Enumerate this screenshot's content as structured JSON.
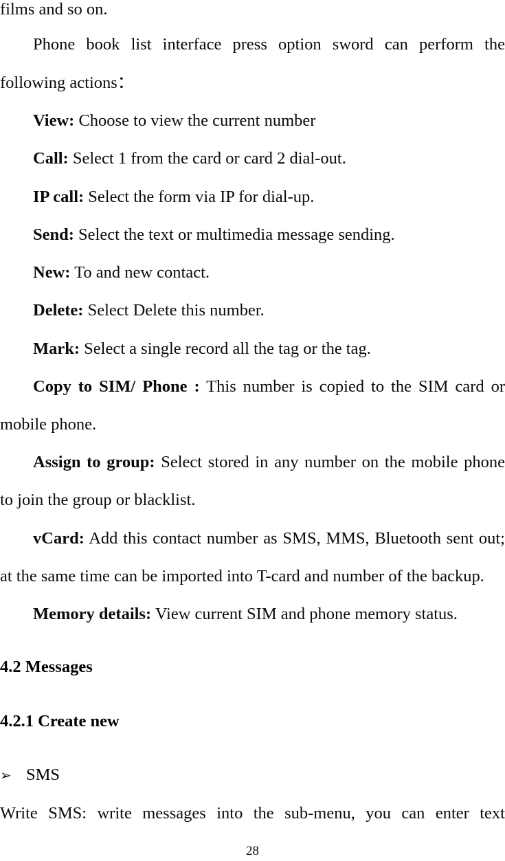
{
  "document": {
    "type": "user-manual-page",
    "page_number": "28",
    "body_font": "serif",
    "text_color": "#0b0b0b",
    "background_color": "#ffffff"
  },
  "content": {
    "continued_line": "films and so on.",
    "intro_paragraph": {
      "line1": "Phone book list interface press option sword can perform the",
      "line2": "following actions："
    },
    "actions": [
      {
        "label": "View:",
        "text": "Choose to view the current number"
      },
      {
        "label": "Call:",
        "text": "Select 1 from the card or card 2 dial-out."
      },
      {
        "label": "IP call:",
        "text": "Select the form via IP for dial-up."
      },
      {
        "label": "Send:",
        "text": "Select the text or multimedia message sending."
      },
      {
        "label": "New:",
        "text": "To and new contact."
      },
      {
        "label": "Delete:",
        "text": "Select Delete this number."
      },
      {
        "label": "Mark:",
        "text": "Select a single record all the tag or the tag."
      }
    ],
    "copy_to_sim": {
      "label": "Copy to SIM/ Phone :",
      "line1": "This number is copied to the SIM card or",
      "line2": "mobile phone."
    },
    "assign_to_group": {
      "label": "Assign to group:",
      "line1": "Select stored in any number on the mobile phone",
      "line2": "to join the group or blacklist."
    },
    "vcard": {
      "label": "vCard:",
      "line1": "Add this contact number as SMS, MMS, Bluetooth sent out;",
      "line2": "at the same time can be imported into T-card and number of the backup."
    },
    "memory_details": {
      "label": "Memory details:",
      "text": "View current SIM and phone memory status."
    },
    "heading_section": "4.2 Messages",
    "heading_subsection": "4.2.1 Create new",
    "bullet": {
      "glyph": "➢",
      "label": "SMS"
    },
    "write_sms_line": "Write SMS: write messages into the sub-menu, you can enter text"
  }
}
